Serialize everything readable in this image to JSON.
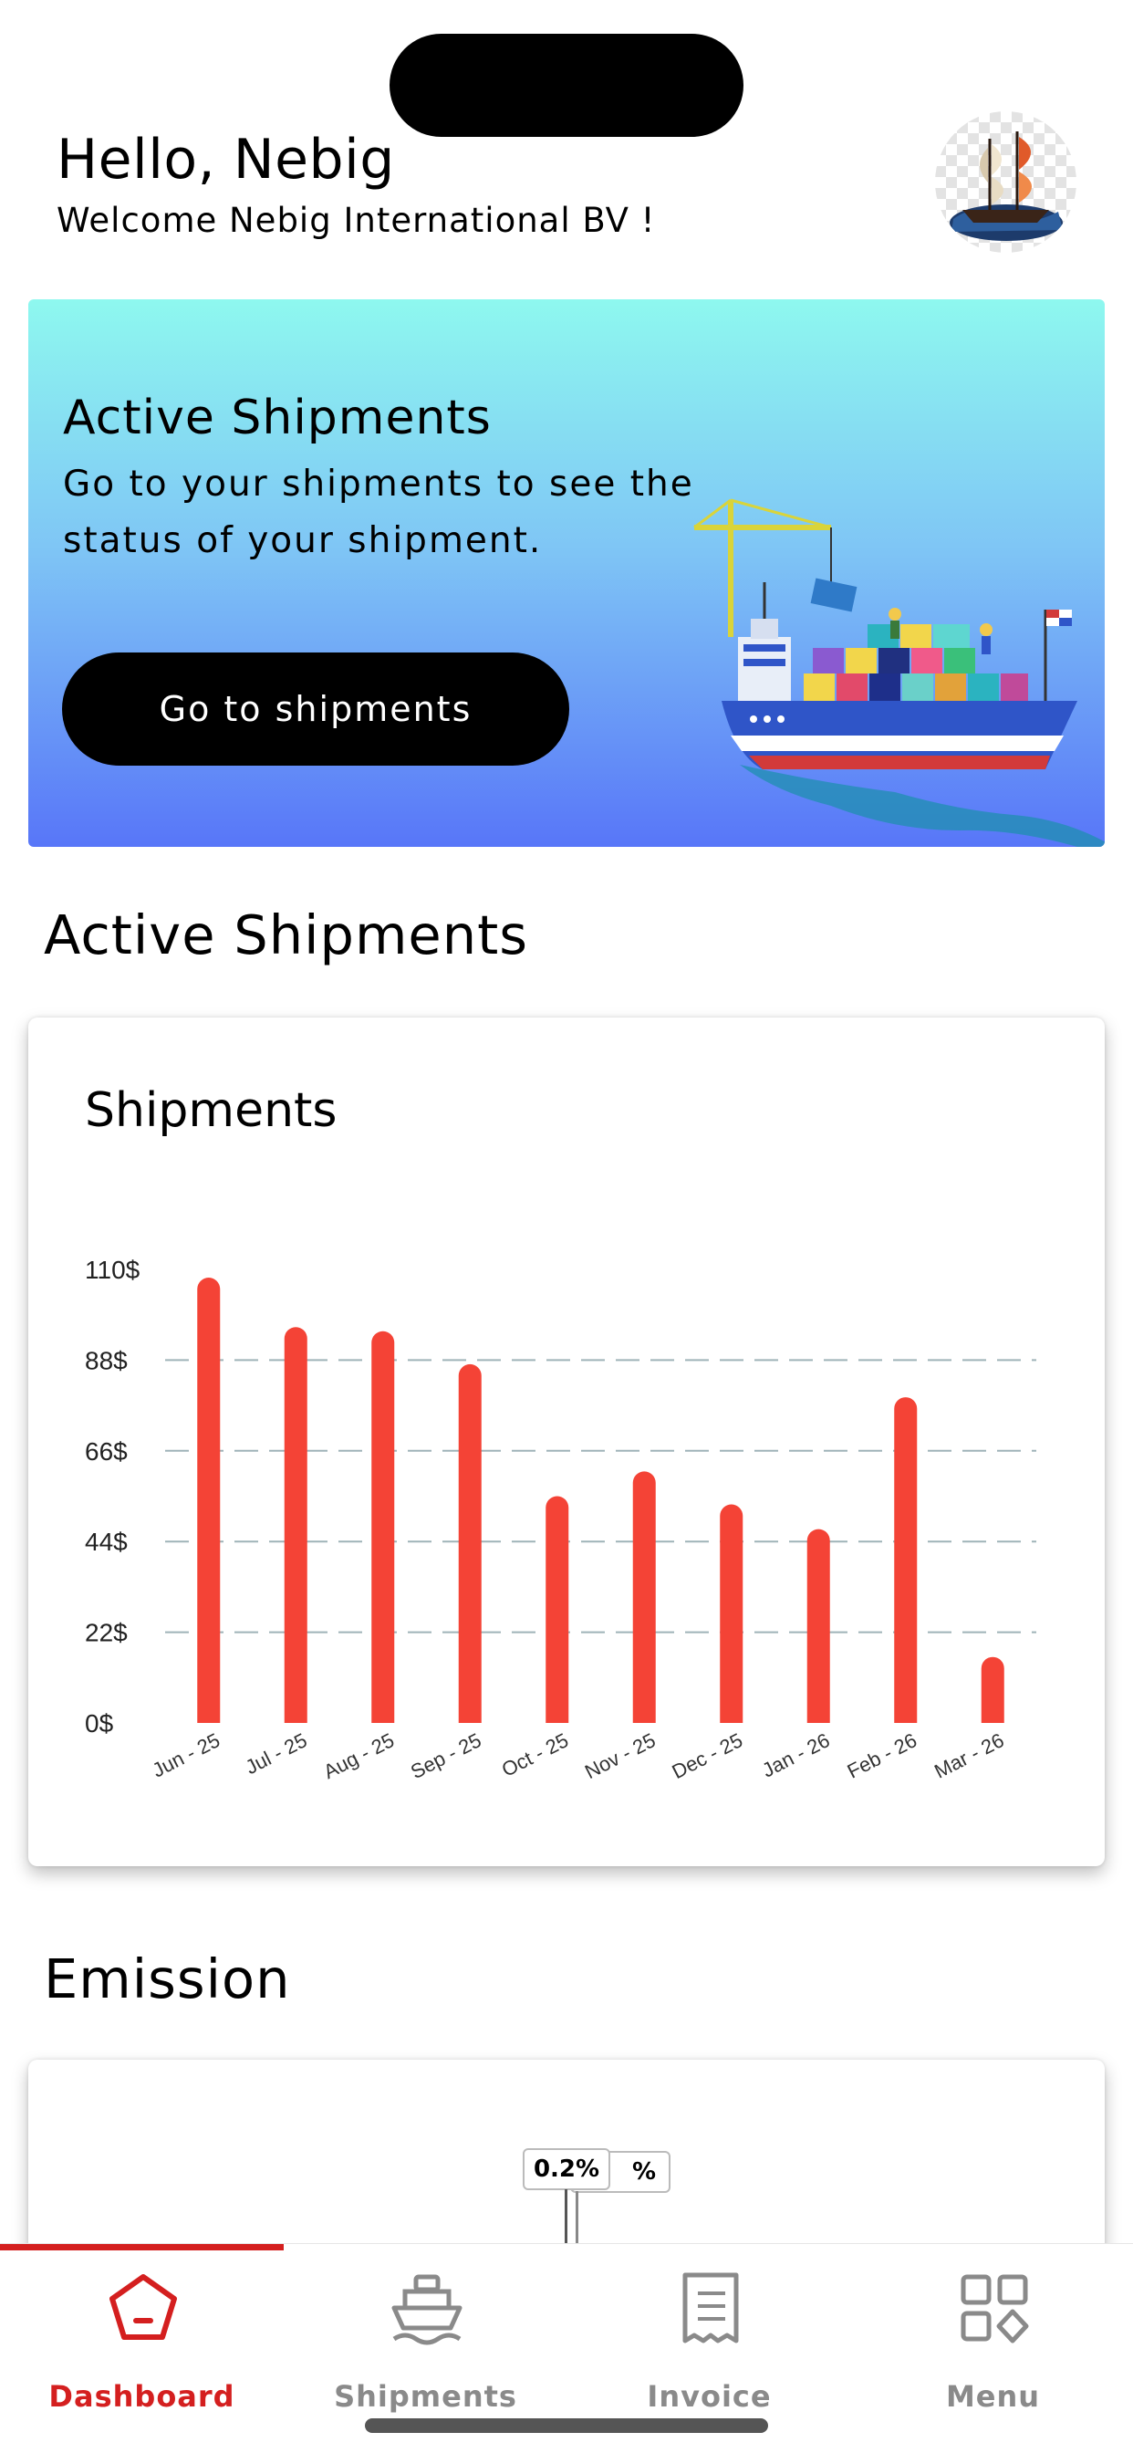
{
  "header": {
    "greeting": "Hello, Nebig",
    "welcome": "Welcome Nebig International BV !"
  },
  "promo": {
    "title": "Active Shipments",
    "text": "Go to your shipments to see the status of your shipment.",
    "button_label": "Go to shipments"
  },
  "sections": {
    "active_title": "Active Shipments",
    "emission_title": "Emission"
  },
  "chart_data": {
    "type": "bar",
    "title": "Shipments",
    "categories": [
      "Jun - 25",
      "Jul - 25",
      "Aug - 25",
      "Sep - 25",
      "Oct - 25",
      "Nov - 25",
      "Dec - 25",
      "Jan - 26",
      "Feb - 26",
      "Mar - 26"
    ],
    "values": [
      108,
      96,
      95,
      87,
      55,
      61,
      53,
      47,
      79,
      16
    ],
    "y_ticks": [
      "0$",
      "22$",
      "44$",
      "66$",
      "88$",
      "110$"
    ],
    "ylim": [
      0,
      110
    ],
    "bar_color": "#f44336",
    "grid": "dashed horizontal"
  },
  "emission": {
    "tooltip_front": "0.2%",
    "tooltip_back": "%"
  },
  "tabbar": {
    "items": [
      {
        "label": "Dashboard",
        "icon": "pentagon-home-icon",
        "active": true
      },
      {
        "label": "Shipments",
        "icon": "ship-icon",
        "active": false
      },
      {
        "label": "Invoice",
        "icon": "receipt-icon",
        "active": false
      },
      {
        "label": "Menu",
        "icon": "grid-menu-icon",
        "active": false
      }
    ],
    "active_color": "#d41f1f",
    "inactive_color": "#8a8a8a"
  }
}
